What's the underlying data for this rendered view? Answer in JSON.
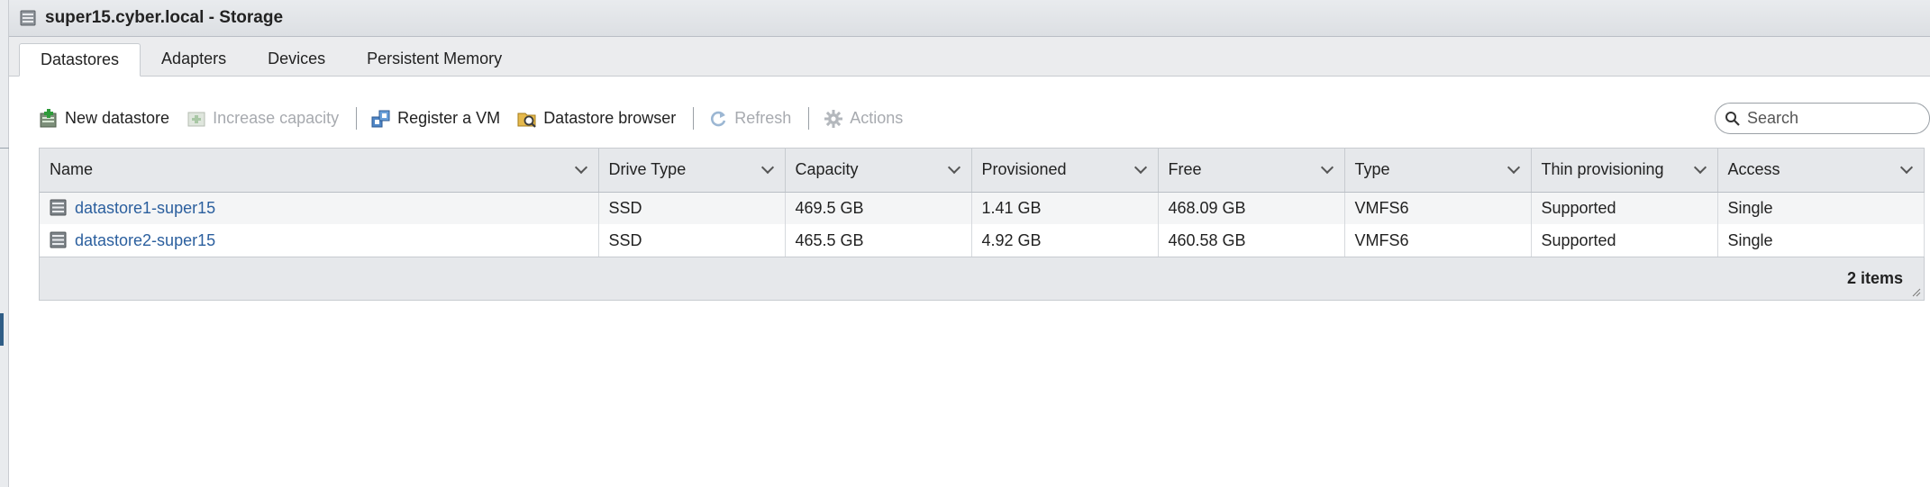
{
  "window": {
    "title": "super15.cyber.local - Storage"
  },
  "tabs": [
    {
      "label": "Datastores",
      "active": true
    },
    {
      "label": "Adapters",
      "active": false
    },
    {
      "label": "Devices",
      "active": false
    },
    {
      "label": "Persistent Memory",
      "active": false
    }
  ],
  "toolbar": {
    "new_datastore": "New datastore",
    "increase_capacity": "Increase capacity",
    "register_vm": "Register a VM",
    "datastore_browser": "Datastore browser",
    "refresh": "Refresh",
    "actions": "Actions"
  },
  "search": {
    "placeholder": "Search"
  },
  "table": {
    "columns": [
      "Name",
      "Drive Type",
      "Capacity",
      "Provisioned",
      "Free",
      "Type",
      "Thin provisioning",
      "Access"
    ],
    "rows": [
      {
        "name": "datastore1-super15",
        "drive_type": "SSD",
        "capacity": "469.5 GB",
        "provisioned": "1.41 GB",
        "free": "468.09 GB",
        "type": "VMFS6",
        "thin_provisioning": "Supported",
        "access": "Single"
      },
      {
        "name": "datastore2-super15",
        "drive_type": "SSD",
        "capacity": "465.5 GB",
        "provisioned": "4.92 GB",
        "free": "460.58 GB",
        "type": "VMFS6",
        "thin_provisioning": "Supported",
        "access": "Single"
      }
    ],
    "footer": "2 items"
  },
  "icons": {
    "title": "storage-icon",
    "new_datastore": "new-datastore-icon",
    "increase_capacity": "increase-capacity-icon",
    "register_vm": "register-vm-icon",
    "datastore_browser": "datastore-browser-icon",
    "refresh": "refresh-icon",
    "actions": "gear-icon",
    "search": "search-icon",
    "row": "datastore-icon"
  },
  "colors": {
    "link": "#2b5f9e",
    "disabled": "#a7aaaf",
    "header_bg": "#e6e8eb"
  }
}
